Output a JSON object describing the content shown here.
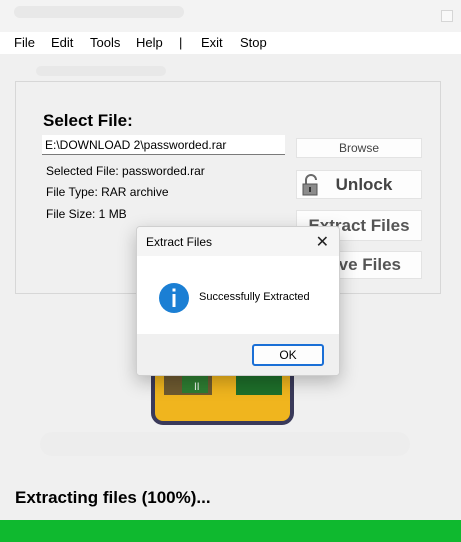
{
  "menu": {
    "items": [
      "File",
      "Edit",
      "Tools",
      "Help",
      "|",
      "Exit",
      "Stop"
    ]
  },
  "main": {
    "select_title": "Select File:",
    "path_value": "E:\\DOWNLOAD 2\\passworded.rar",
    "selected_file": "Selected File: passworded.rar",
    "file_type": "File Type: RAR archive",
    "file_size": "File Size: 1 MB",
    "browse_label": "Browse",
    "unlock_label": "Unlock",
    "extract_label": "Extract Files",
    "save_label": "ve Files"
  },
  "status": {
    "text": "Extracting files (100%)...",
    "progress": 1.0
  },
  "dialog": {
    "title": "Extract Files",
    "close_glyph": "✕",
    "message": "Successfully Extracted",
    "ok_label": "OK",
    "icon": "info-icon"
  },
  "colors": {
    "progress": "#0fb92f",
    "info_icon": "#1b7fd4",
    "ok_border": "#1a6fd6"
  }
}
